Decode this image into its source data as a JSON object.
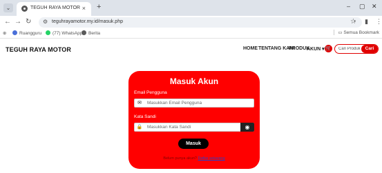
{
  "browser": {
    "tab_title": "TEGUH RAYA MOTOR",
    "tab_close": "×",
    "new_tab": "+",
    "window_minimize": "–",
    "window_restore": "▢",
    "window_close": "✕",
    "url": "teguhrayamotor.my.id/masuk.php",
    "bookmarks": [
      {
        "label": "Ruangguru",
        "color": "#4a6fd8"
      },
      {
        "label": "(77) WhatsApp",
        "color": "#25d366"
      },
      {
        "label": "Berita",
        "color": "#5a5a5a"
      }
    ],
    "all_bookmarks": "Semua Bookmark"
  },
  "site": {
    "brand": "TEGUH RAYA MOTOR",
    "nav": [
      "HOME",
      "TENTANG KAMI",
      "PRODUK",
      "AKUN ▾"
    ],
    "search_placeholder": "Cari Produk",
    "search_button": "Cari",
    "accent_color": "#ff0000"
  },
  "login": {
    "title": "Masuk Akun",
    "email_label": "Email Pengguna",
    "email_placeholder": "Masukkan Email Pengguna",
    "password_label": "Kata Sandi",
    "password_placeholder": "Masukkan Kata Sandi",
    "submit": "Masuk",
    "register_prompt": "Belum punya akun?",
    "register_link": "Daftar sekarang"
  },
  "icons": [
    "menu-chevron-icon",
    "back-icon",
    "forward-icon",
    "reload-icon",
    "site-info-icon",
    "star-icon",
    "extensions-icon",
    "profile-icon",
    "more-icon",
    "cart-icon",
    "envelope-icon",
    "lock-icon",
    "eye-icon"
  ]
}
